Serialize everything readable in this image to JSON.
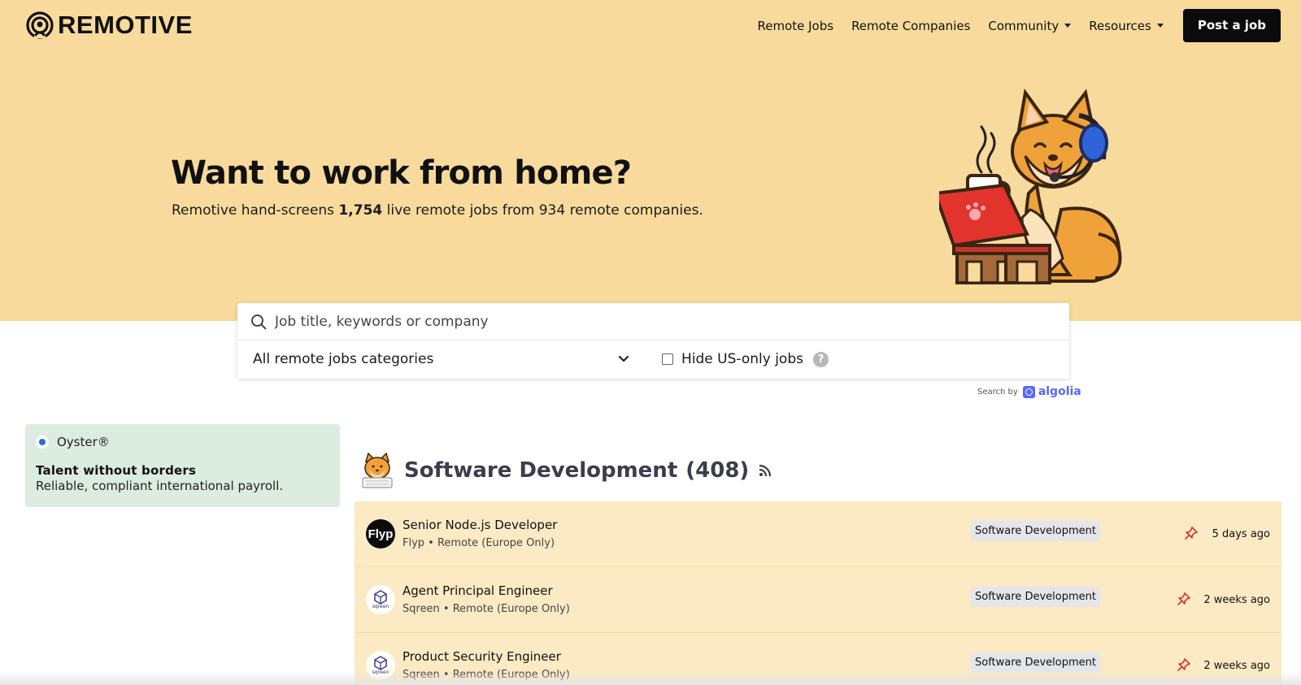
{
  "brand": {
    "name": "REMOTIVE"
  },
  "nav": {
    "items": [
      {
        "label": "Remote Jobs",
        "dropdown": false
      },
      {
        "label": "Remote Companies",
        "dropdown": false
      },
      {
        "label": "Community",
        "dropdown": true
      },
      {
        "label": "Resources",
        "dropdown": true
      }
    ],
    "post_job_label": "Post a job"
  },
  "hero": {
    "title": "Want to work from home?",
    "subtitle_prefix": "Remotive hand-screens",
    "job_count": "1,754",
    "subtitle_suffix": "live remote jobs from 934 remote companies."
  },
  "search": {
    "placeholder": "Job title, keywords or company",
    "category_value": "All remote jobs categories",
    "hide_us_label": "Hide US-only jobs",
    "hide_us_checked": false,
    "help_icon": "?",
    "powered_by": "Search by",
    "powered_brand": "algolia"
  },
  "ad": {
    "brand": "Oyster®",
    "title": "Talent without borders",
    "description": "Reliable, compliant international payroll."
  },
  "section": {
    "title": "Software Development",
    "count": "(408)"
  },
  "jobs": [
    {
      "title": "Senior Node.js Developer",
      "company": "Flyp",
      "location": "Remote (Europe Only)",
      "meta": "Flyp • Remote (Europe Only)",
      "logo_text": "Flyp",
      "tag": "Software Development",
      "posted": "5 days ago"
    },
    {
      "title": "Agent Principal Engineer",
      "company": "Sqreen",
      "location": "Remote (Europe Only)",
      "meta": "Sqreen • Remote (Europe Only)",
      "logo_text": "sqreen",
      "tag": "Software Development",
      "posted": "2 weeks ago"
    },
    {
      "title": "Product Security Engineer",
      "company": "Sqreen",
      "location": "Remote (Europe Only)",
      "meta": "Sqreen • Remote (Europe Only)",
      "logo_text": "sqreen",
      "tag": "Software Development",
      "posted": "2 weeks ago"
    }
  ],
  "colors": {
    "hero_bg": "#f8da9c",
    "job_row_bg": "#fbeac3",
    "ad_bg": "#dcece1",
    "pin_red": "#d9342b",
    "algolia_blue": "#5468ff"
  }
}
